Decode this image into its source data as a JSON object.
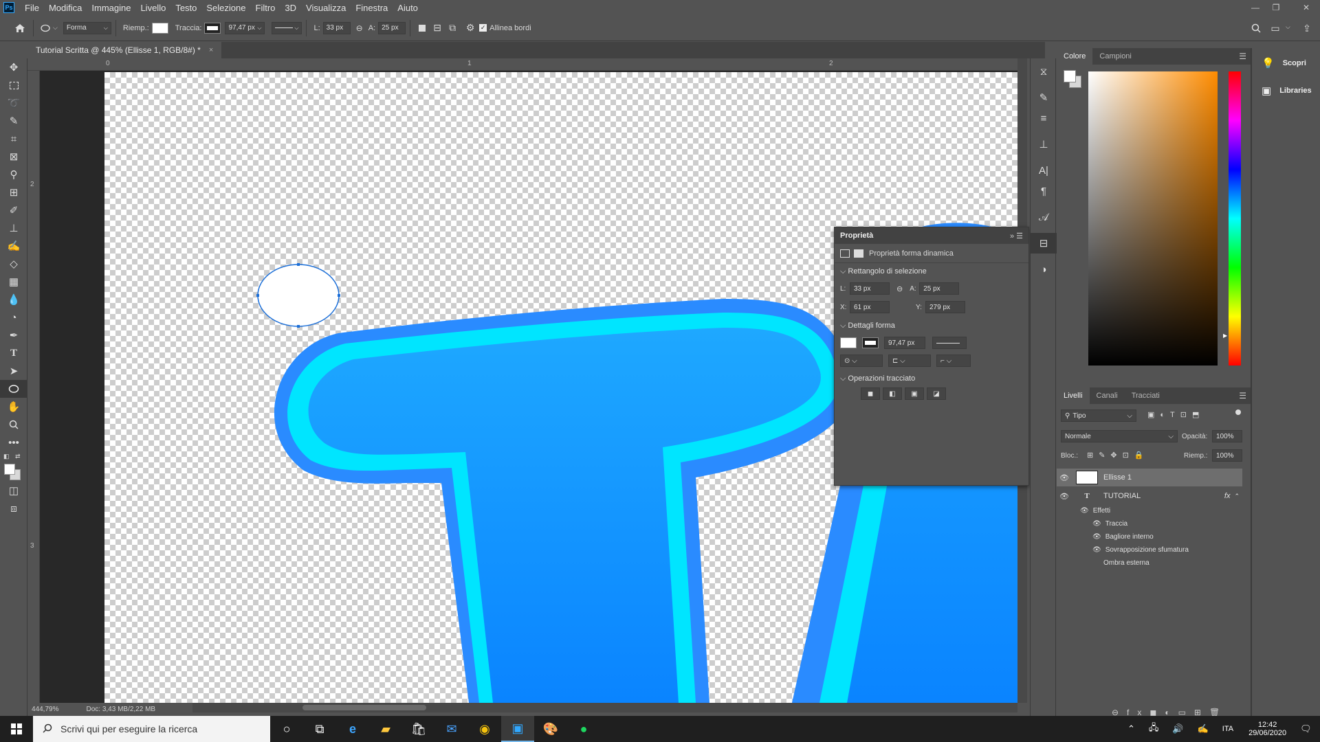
{
  "app": {
    "logo": "Ps"
  },
  "menu": [
    "File",
    "Modifica",
    "Immagine",
    "Livello",
    "Testo",
    "Selezione",
    "Filtro",
    "3D",
    "Visualizza",
    "Finestra",
    "Aiuto"
  ],
  "window_controls": {
    "minimize": "—",
    "restore": "❐",
    "close": "✕"
  },
  "options": {
    "tool_mode": "Forma",
    "fill_label": "Riemp.:",
    "stroke_label": "Traccia:",
    "stroke_width": "97,47 px",
    "width_label": "L:",
    "width_value": "33 px",
    "link_icon": "link-icon",
    "height_label": "A:",
    "height_value": "25 px",
    "align_edges_label": "Allinea bordi",
    "align_edges_checked": true
  },
  "document_tab": {
    "title": "Tutorial Scritta @ 445% (Ellisse 1, RGB/8#) *",
    "close": "×"
  },
  "rulers": {
    "top": [
      "0",
      "1",
      "2"
    ],
    "left": [
      "2",
      "3"
    ]
  },
  "status": {
    "zoom": "444,79%",
    "doc": "Doc: 3,43 MB/2,22 MB"
  },
  "properties": {
    "title": "Proprietà",
    "subtitle": "Proprietà forma dinamica",
    "section_bbox": "Rettangolo di selezione",
    "w_label": "L:",
    "w_value": "33 px",
    "h_label": "A:",
    "h_value": "25 px",
    "x_label": "X:",
    "x_value": "61 px",
    "y_label": "Y:",
    "y_value": "279 px",
    "section_shape": "Dettagli forma",
    "stroke_width": "97,47 px",
    "section_path_ops": "Operazioni tracciato"
  },
  "color_panel": {
    "tabs": [
      "Colore",
      "Campioni"
    ],
    "active_tab": 0,
    "hue_color": "#ff8c00"
  },
  "far_right": [
    {
      "icon": "lightbulb-icon",
      "label": "Scopri"
    },
    {
      "icon": "libraries-icon",
      "label": "Libraries"
    }
  ],
  "layers_panel": {
    "tabs": [
      "Livelli",
      "Canali",
      "Tracciati"
    ],
    "active_tab": 0,
    "filter": "Tipo",
    "blend_mode": "Normale",
    "opacity_label": "Opacità:",
    "opacity_value": "100%",
    "lock_label": "Bloc.:",
    "fill_label": "Riemp.:",
    "fill_value": "100%",
    "layers": [
      {
        "name": "Ellisse 1",
        "type": "shape",
        "selected": true
      },
      {
        "name": "TUTORIAL",
        "type": "text",
        "fx": "fx"
      }
    ],
    "effects_label": "Effetti",
    "effects": [
      "Traccia",
      "Bagliore interno",
      "Sovrapposizione sfumatura",
      "Ombra esterna"
    ],
    "effects_visible": [
      true,
      true,
      true,
      false
    ]
  },
  "taskbar": {
    "search_placeholder": "Scrivi qui per eseguire la ricerca",
    "language": "ITA",
    "time": "12:42",
    "date": "29/06/2020"
  }
}
